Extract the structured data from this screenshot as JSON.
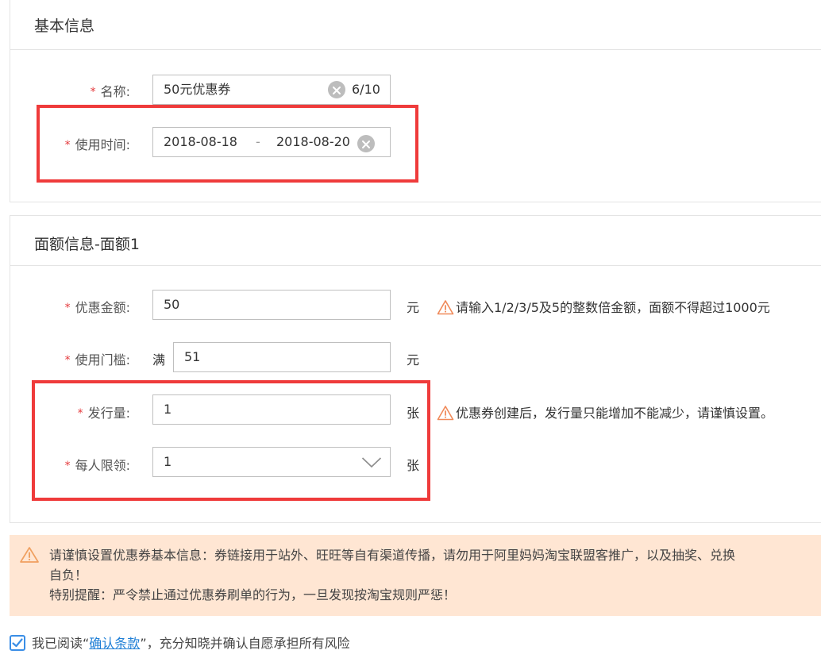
{
  "basic": {
    "title": "基本信息",
    "name_label": "名称:",
    "name_value": "50元优惠券",
    "name_counter": "6/10",
    "time_label": "使用时间:",
    "time_start": "2018-08-18",
    "time_sep": "-",
    "time_end": "2018-08-20"
  },
  "amount": {
    "title": "面额信息-面额1",
    "discount_label": "优惠金额:",
    "discount_value": "50",
    "discount_unit": "元",
    "discount_hint": "请输入1/2/3/5及5的整数倍金额，面额不得超过1000元",
    "threshold_label": "使用门槛:",
    "threshold_prefix": "满",
    "threshold_value": "51",
    "threshold_unit": "元",
    "issue_label": "发行量:",
    "issue_value": "1",
    "issue_unit": "张",
    "issue_hint": "优惠券创建后，发行量只能增加不能减少，请谨慎设置。",
    "limit_label": "每人限领:",
    "limit_value": "1",
    "limit_unit": "张"
  },
  "notice": {
    "line1": "请谨慎设置优惠券基本信息：券链接用于站外、旺旺等自有渠道传播，请勿用于阿里妈妈淘宝联盟客推广，以及抽奖、兑换",
    "line2": "自负！",
    "line3": "特别提醒：严令禁止通过优惠券刷单的行为，一旦发现按淘宝规则严惩！"
  },
  "agree": {
    "prefix": "我已阅读“",
    "link": "确认条款",
    "suffix": "”，充分知晓并确认自愿承担所有风险",
    "checked": true
  },
  "colors": {
    "accent_red": "#ef3b3b",
    "required_star": "#e4393c",
    "notice_bg": "#ffe6d3",
    "link": "#1f7fd6",
    "warning_orange": "#f08a5a"
  }
}
